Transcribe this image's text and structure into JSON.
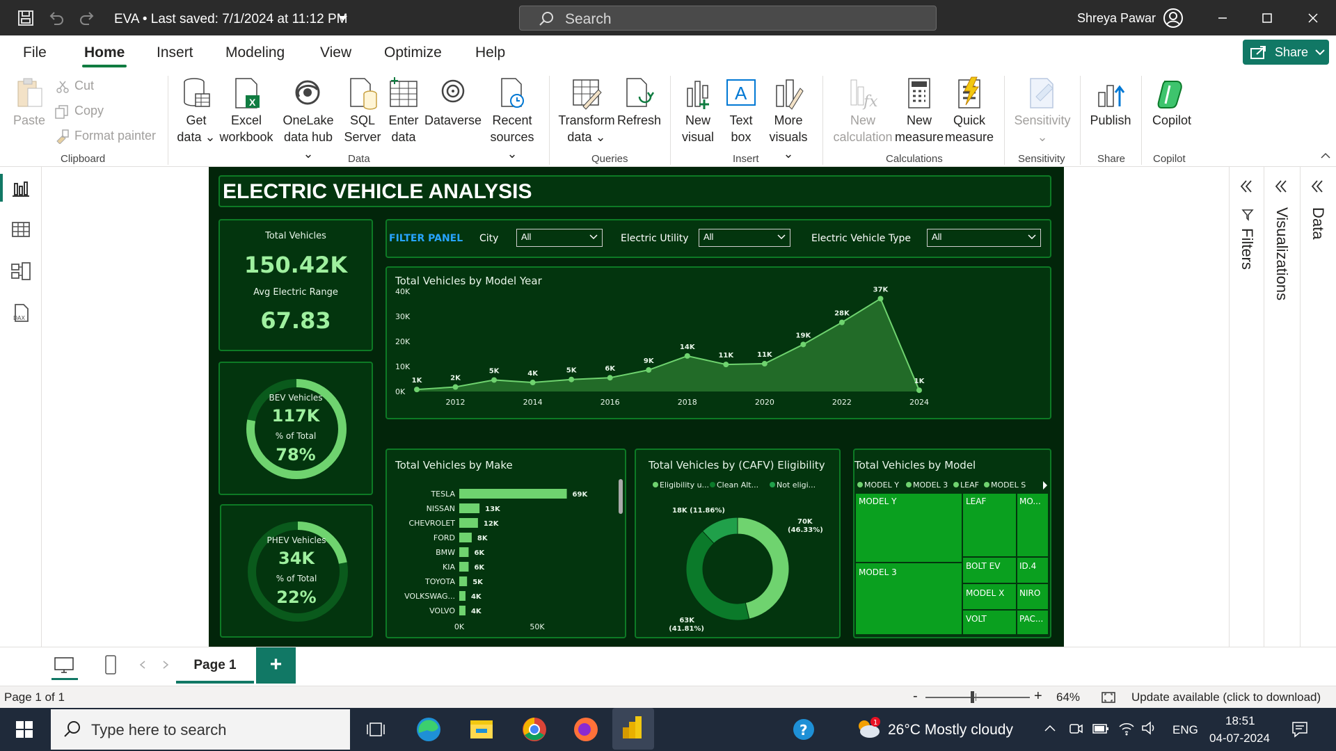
{
  "titlebar": {
    "doc_title": "EVA • Last saved: 7/1/2024 at 11:12 PM",
    "search_placeholder": "Search",
    "user_name": "Shreya Pawar"
  },
  "menu": {
    "tabs": [
      "File",
      "Home",
      "Insert",
      "Modeling",
      "View",
      "Optimize",
      "Help"
    ],
    "active": "Home",
    "share_label": "Share"
  },
  "ribbon": {
    "clipboard": {
      "paste": "Paste",
      "cut": "Cut",
      "copy": "Copy",
      "format_painter": "Format painter",
      "label": "Clipboard"
    },
    "data": {
      "get_data": [
        "Get",
        "data"
      ],
      "excel": [
        "Excel",
        "workbook"
      ],
      "onelake": [
        "OneLake",
        "data hub"
      ],
      "sql": [
        "SQL",
        "Server"
      ],
      "enter": [
        "Enter",
        "data"
      ],
      "dataverse": "Dataverse",
      "recent": [
        "Recent",
        "sources"
      ],
      "label": "Data"
    },
    "queries": {
      "transform": [
        "Transform",
        "data"
      ],
      "refresh": "Refresh",
      "label": "Queries"
    },
    "insert": {
      "new_visual": [
        "New",
        "visual"
      ],
      "text_box": [
        "Text",
        "box"
      ],
      "more_visuals": [
        "More",
        "visuals"
      ],
      "label": "Insert"
    },
    "calculations": {
      "new_calc": [
        "New",
        "calculation"
      ],
      "new_measure": [
        "New",
        "measure"
      ],
      "quick_measure": [
        "Quick",
        "measure"
      ],
      "label": "Calculations"
    },
    "sensitivity": {
      "btn": "Sensitivity",
      "label": "Sensitivity"
    },
    "share": {
      "publish": "Publish",
      "label": "Share"
    },
    "copilot": {
      "btn": "Copilot",
      "label": "Copilot"
    }
  },
  "report": {
    "title": "ELECTRIC VEHICLE ANALYSIS",
    "kpi": {
      "total_vehicles_label": "Total Vehicles",
      "total_vehicles": "150.42K",
      "avg_range_label": "Avg Electric Range",
      "avg_range": "67.83"
    },
    "bev": {
      "label": "BEV Vehicles",
      "value": "117K",
      "pct_label": "% of Total",
      "pct": "78%",
      "fraction": 0.78
    },
    "phev": {
      "label": "PHEV Vehicles",
      "value": "34K",
      "pct_label": "% of Total",
      "pct": "22%",
      "fraction": 0.22
    },
    "filter": {
      "title": "FILTER PANEL",
      "city_label": "City",
      "city_value": "All",
      "utility_label": "Electric Utility",
      "utility_value": "All",
      "type_label": "Electric Vehicle Type",
      "type_value": "All"
    },
    "treemap": {
      "title": "Total Vehicles by Model",
      "legend": [
        "MODEL Y",
        "MODEL 3",
        "LEAF",
        "MODEL S"
      ],
      "tiles": [
        "MODEL Y",
        "MODEL 3",
        "LEAF",
        "MO...",
        "BOLT EV",
        "ID.4",
        "MODEL X",
        "NIRO",
        "VOLT",
        "PAC..."
      ]
    }
  },
  "chart_data": [
    {
      "type": "area",
      "title": "Total Vehicles by Model Year",
      "x": [
        2011,
        2012,
        2013,
        2014,
        2015,
        2016,
        2017,
        2018,
        2019,
        2020,
        2021,
        2022,
        2023,
        2024
      ],
      "values": [
        0.8,
        1.8,
        4.6,
        3.6,
        4.8,
        5.5,
        8.6,
        14.2,
        10.8,
        11.1,
        18.8,
        27.6,
        37.1,
        0.5
      ],
      "data_labels": [
        "1K",
        "2K",
        "5K",
        "4K",
        "5K",
        "6K",
        "9K",
        "14K",
        "11K",
        "11K",
        "19K",
        "28K",
        "37K",
        "1K"
      ],
      "x_ticks": [
        "2012",
        "2014",
        "2016",
        "2018",
        "2020",
        "2022",
        "2024"
      ],
      "y_ticks": [
        "0K",
        "10K",
        "20K",
        "30K",
        "40K"
      ],
      "ylim": [
        0,
        40
      ],
      "unit": "K"
    },
    {
      "type": "bar",
      "title": "Total Vehicles by Make",
      "categories": [
        "TESLA",
        "NISSAN",
        "CHEVROLET",
        "FORD",
        "BMW",
        "KIA",
        "TOYOTA",
        "VOLKSWAG...",
        "VOLVO"
      ],
      "values": [
        69,
        13,
        12,
        8,
        6,
        6,
        5,
        4,
        4
      ],
      "data_labels": [
        "69K",
        "13K",
        "12K",
        "8K",
        "6K",
        "6K",
        "5K",
        "4K",
        "4K"
      ],
      "x_ticks": [
        "0K",
        "50K"
      ],
      "xlim": [
        0,
        100
      ]
    },
    {
      "type": "pie",
      "title": "Total Vehicles by (CAFV) Eligibility",
      "legend": [
        "Eligibility u...",
        "Clean Alt...",
        "Not eligi..."
      ],
      "slices": [
        {
          "value": 70,
          "label": "70K",
          "pct": "(46.33%)",
          "color": "#6fd36f"
        },
        {
          "value": 63,
          "label": "63K",
          "pct": "(41.81%)",
          "color": "#0b7a2a"
        },
        {
          "value": 18,
          "label": "18K (11.86%)",
          "pct": "",
          "color": "#20a04a"
        }
      ]
    }
  ],
  "panes": {
    "filters": "Filters",
    "visualizations": "Visualizations",
    "data": "Data"
  },
  "pages": {
    "tab": "Page 1"
  },
  "status": {
    "page": "Page 1 of 1",
    "zoom": "64%",
    "update": "Update available (click to download)",
    "zoom_fraction": 0.5
  },
  "taskbar": {
    "search": "Type here to search",
    "weather": "26°C  Mostly cloudy",
    "lang": "ENG",
    "time": "18:51",
    "date": "04-07-2024",
    "notif_count": "1"
  },
  "colors": {
    "accent": "#117865",
    "report_bg": "#02250a",
    "panel_bg": "#03350e",
    "bright_green": "#6fd36f"
  }
}
